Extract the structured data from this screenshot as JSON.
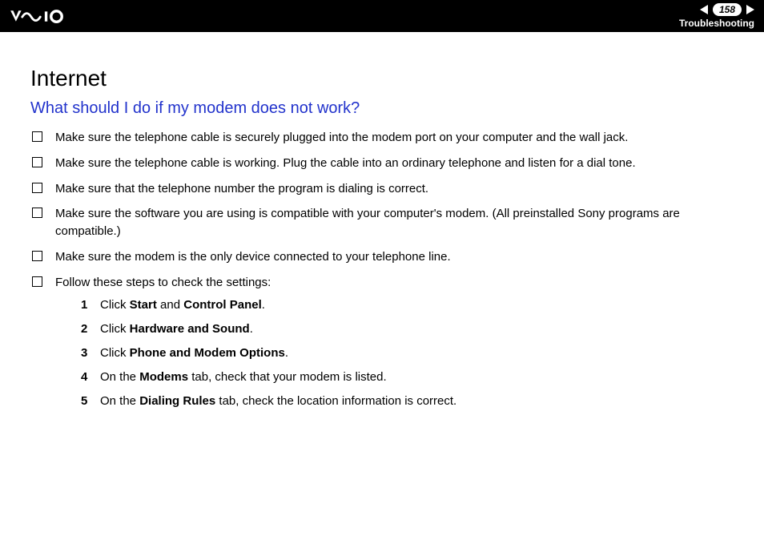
{
  "header": {
    "page_number": "158",
    "breadcrumb": "Troubleshooting"
  },
  "body": {
    "section_title": "Internet",
    "question": "What should I do if my modem does not work?",
    "bullets": [
      "Make sure the telephone cable is securely plugged into the modem port on your computer and the wall jack.",
      "Make sure the telephone cable is working. Plug the cable into an ordinary telephone and listen for a dial tone.",
      "Make sure that the telephone number the program is dialing is correct.",
      "Make sure the software you are using is compatible with your computer's modem. (All preinstalled Sony programs are compatible.)",
      "Make sure the modem is the only device connected to your telephone line.",
      "Follow these steps to check the settings:"
    ],
    "steps": [
      {
        "n": "1",
        "pre": "Click ",
        "bold": [
          "Start",
          "Control Panel"
        ],
        "mid": " and ",
        "post": "."
      },
      {
        "n": "2",
        "pre": "Click ",
        "bold": [
          "Hardware and Sound"
        ],
        "mid": "",
        "post": "."
      },
      {
        "n": "3",
        "pre": "Click ",
        "bold": [
          "Phone and Modem Options"
        ],
        "mid": "",
        "post": "."
      },
      {
        "n": "4",
        "pre": "On the ",
        "bold": [
          "Modems"
        ],
        "mid": "",
        "post": " tab, check that your modem is listed."
      },
      {
        "n": "5",
        "pre": "On the ",
        "bold": [
          "Dialing Rules"
        ],
        "mid": "",
        "post": " tab, check the location information is correct."
      }
    ]
  }
}
